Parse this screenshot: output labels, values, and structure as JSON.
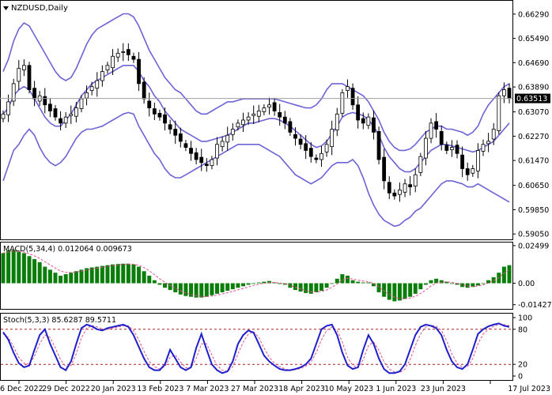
{
  "symbol_label": "NZDUSD,Daily",
  "current_price": "0.63513",
  "colors": {
    "background": "#ffffff",
    "frame": "#000000",
    "bull": "#ffffff",
    "bear": "#000000",
    "bollinger": "#6b63d6",
    "price_line": "#a0a0a0",
    "price_box": "#000000",
    "price_box_text": "#ffffff",
    "macd_hist": "#0a7d0a",
    "macd_signal": "#e0508a",
    "stoch_main": "#1f1fcc",
    "stoch_signal": "#e0508a",
    "stoch_level": "#b02020"
  },
  "price_panel": {
    "axis_labels": [
      "0.66290",
      "0.65490",
      "0.64690",
      "0.63890",
      "0.63070",
      "0.62270",
      "0.61470",
      "0.60650",
      "0.59850",
      "0.59050"
    ]
  },
  "macd_panel": {
    "label": "MACD(5,34,4) 0.012064 0.009673",
    "axis_labels": [
      "0.02499",
      "0.00",
      "-0.01427"
    ]
  },
  "stoch_panel": {
    "label": "Stoch(5,3,3) 85.6287 89.5711",
    "axis_labels": [
      "100",
      "80",
      "20",
      "0"
    ]
  },
  "time_axis": {
    "labels": [
      "6 Dec 2022",
      "29 Dec 2022",
      "20 Jan 2023",
      "13 Feb 2023",
      "7 Mar 2023",
      "27 Mar 2023",
      "18 Apr 2023",
      "10 May 2023",
      "1 Jun 2023",
      "23 Jun 2023",
      "17 Jul 2023"
    ]
  },
  "chart_data": {
    "type": "line",
    "title": "NZDUSD,Daily",
    "price_range": [
      0.5895,
      0.6665
    ],
    "close": [
      0.63,
      0.634,
      0.64,
      0.645,
      0.646,
      0.638,
      0.635,
      0.636,
      0.633,
      0.631,
      0.629,
      0.627,
      0.629,
      0.63,
      0.632,
      0.635,
      0.637,
      0.639,
      0.641,
      0.644,
      0.646,
      0.649,
      0.65,
      0.6505,
      0.6495,
      0.648,
      0.64,
      0.635,
      0.632,
      0.63,
      0.629,
      0.627,
      0.625,
      0.623,
      0.621,
      0.619,
      0.617,
      0.615,
      0.614,
      0.613,
      0.615,
      0.62,
      0.621,
      0.623,
      0.625,
      0.627,
      0.628,
      0.629,
      0.63,
      0.631,
      0.632,
      0.633,
      0.631,
      0.629,
      0.627,
      0.624,
      0.622,
      0.62,
      0.618,
      0.616,
      0.615,
      0.617,
      0.62,
      0.625,
      0.63,
      0.637,
      0.639,
      0.633,
      0.628,
      0.627,
      0.629,
      0.624,
      0.615,
      0.608,
      0.604,
      0.603,
      0.605,
      0.607,
      0.606,
      0.61,
      0.616,
      0.622,
      0.627,
      0.625,
      0.62,
      0.618,
      0.619,
      0.617,
      0.612,
      0.61,
      0.612,
      0.618,
      0.62,
      0.621,
      0.625,
      0.636,
      0.638,
      0.6351
    ],
    "bb_upper": [
      0.644,
      0.648,
      0.654,
      0.658,
      0.66,
      0.659,
      0.656,
      0.653,
      0.65,
      0.647,
      0.644,
      0.642,
      0.641,
      0.642,
      0.645,
      0.649,
      0.653,
      0.656,
      0.658,
      0.659,
      0.66,
      0.661,
      0.662,
      0.663,
      0.663,
      0.662,
      0.659,
      0.655,
      0.651,
      0.648,
      0.645,
      0.642,
      0.64,
      0.638,
      0.637,
      0.635,
      0.633,
      0.631,
      0.63,
      0.63,
      0.631,
      0.632,
      0.633,
      0.634,
      0.634,
      0.6345,
      0.635,
      0.635,
      0.635,
      0.635,
      0.635,
      0.635,
      0.635,
      0.6345,
      0.634,
      0.6335,
      0.633,
      0.6325,
      0.632,
      0.632,
      0.633,
      0.635,
      0.638,
      0.64,
      0.64,
      0.64,
      0.639,
      0.638,
      0.637,
      0.636,
      0.634,
      0.631,
      0.628,
      0.624,
      0.621,
      0.619,
      0.618,
      0.618,
      0.6185,
      0.62,
      0.622,
      0.624,
      0.625,
      0.626,
      0.626,
      0.625,
      0.625,
      0.6245,
      0.624,
      0.623,
      0.624,
      0.626,
      0.63,
      0.633,
      0.635,
      0.637,
      0.639,
      0.64
    ],
    "bb_middle": [
      0.63,
      0.632,
      0.636,
      0.638,
      0.639,
      0.638,
      0.635,
      0.632,
      0.629,
      0.627,
      0.626,
      0.626,
      0.628,
      0.63,
      0.633,
      0.636,
      0.638,
      0.64,
      0.641,
      0.642,
      0.643,
      0.644,
      0.645,
      0.646,
      0.646,
      0.646,
      0.644,
      0.641,
      0.639,
      0.636,
      0.634,
      0.631,
      0.629,
      0.627,
      0.625,
      0.624,
      0.623,
      0.622,
      0.621,
      0.621,
      0.6215,
      0.622,
      0.6225,
      0.623,
      0.624,
      0.625,
      0.626,
      0.627,
      0.627,
      0.6275,
      0.628,
      0.6285,
      0.6285,
      0.628,
      0.627,
      0.626,
      0.6245,
      0.623,
      0.6215,
      0.62,
      0.619,
      0.6195,
      0.621,
      0.6235,
      0.626,
      0.629,
      0.63,
      0.6305,
      0.63,
      0.6295,
      0.628,
      0.626,
      0.623,
      0.619,
      0.616,
      0.614,
      0.612,
      0.611,
      0.611,
      0.612,
      0.614,
      0.616,
      0.618,
      0.619,
      0.62,
      0.62,
      0.6195,
      0.619,
      0.6185,
      0.618,
      0.6175,
      0.618,
      0.619,
      0.62,
      0.621,
      0.623,
      0.625,
      0.627
    ],
    "bb_lower": [
      0.608,
      0.613,
      0.618,
      0.62,
      0.623,
      0.625,
      0.623,
      0.619,
      0.616,
      0.614,
      0.613,
      0.614,
      0.616,
      0.619,
      0.622,
      0.624,
      0.625,
      0.625,
      0.6255,
      0.626,
      0.627,
      0.628,
      0.629,
      0.63,
      0.6305,
      0.63,
      0.626,
      0.623,
      0.62,
      0.617,
      0.615,
      0.612,
      0.61,
      0.609,
      0.609,
      0.61,
      0.611,
      0.612,
      0.613,
      0.614,
      0.615,
      0.616,
      0.617,
      0.618,
      0.619,
      0.62,
      0.62,
      0.62,
      0.62,
      0.62,
      0.619,
      0.618,
      0.617,
      0.616,
      0.614,
      0.612,
      0.61,
      0.609,
      0.608,
      0.607,
      0.608,
      0.609,
      0.611,
      0.613,
      0.614,
      0.614,
      0.614,
      0.615,
      0.613,
      0.609,
      0.604,
      0.6,
      0.597,
      0.595,
      0.594,
      0.593,
      0.5935,
      0.595,
      0.596,
      0.598,
      0.599,
      0.601,
      0.603,
      0.605,
      0.607,
      0.608,
      0.608,
      0.6075,
      0.607,
      0.606,
      0.606,
      0.607,
      0.606,
      0.605,
      0.604,
      0.603,
      0.602,
      0.601
    ],
    "macd": {
      "range": [
        -0.016,
        0.026
      ],
      "histogram": [
        0.02,
        0.022,
        0.022,
        0.021,
        0.02,
        0.018,
        0.016,
        0.014,
        0.011,
        0.009,
        0.007,
        0.005,
        0.006,
        0.007,
        0.008,
        0.009,
        0.01,
        0.0105,
        0.011,
        0.0115,
        0.012,
        0.0125,
        0.0128,
        0.013,
        0.013,
        0.0125,
        0.011,
        0.008,
        0.005,
        0.002,
        -0.001,
        -0.003,
        -0.0045,
        -0.006,
        -0.0075,
        -0.0085,
        -0.009,
        -0.0095,
        -0.0095,
        -0.009,
        -0.008,
        -0.007,
        -0.006,
        -0.005,
        -0.004,
        -0.003,
        -0.002,
        -0.001,
        0.0,
        0.0005,
        0.001,
        0.0015,
        0.0005,
        -0.0005,
        -0.001,
        -0.003,
        -0.0045,
        -0.0055,
        -0.0065,
        -0.007,
        -0.006,
        -0.005,
        -0.003,
        0.0,
        0.003,
        0.006,
        0.005,
        0.002,
        0.001,
        0.0005,
        0.0005,
        -0.002,
        -0.006,
        -0.009,
        -0.011,
        -0.012,
        -0.0115,
        -0.0105,
        -0.009,
        -0.007,
        -0.004,
        -0.001,
        0.002,
        0.003,
        0.002,
        0.001,
        0.0,
        -0.001,
        -0.0025,
        -0.003,
        -0.0025,
        -0.0015,
        0.0,
        0.002,
        0.004,
        0.007,
        0.011,
        0.012
      ]
    },
    "stoch": {
      "range": [
        0,
        100
      ],
      "levels": [
        80,
        20
      ],
      "k": [
        75,
        62,
        40,
        22,
        15,
        18,
        45,
        70,
        80,
        55,
        35,
        15,
        10,
        25,
        55,
        82,
        88,
        85,
        80,
        78,
        82,
        84,
        86,
        88,
        84,
        70,
        50,
        30,
        15,
        10,
        10,
        20,
        45,
        30,
        15,
        10,
        15,
        48,
        72,
        45,
        20,
        10,
        5,
        8,
        25,
        55,
        70,
        78,
        74,
        55,
        35,
        25,
        18,
        12,
        10,
        10,
        12,
        15,
        20,
        30,
        55,
        80,
        86,
        88,
        70,
        40,
        18,
        12,
        15,
        45,
        70,
        55,
        30,
        12,
        5,
        5,
        8,
        20,
        45,
        70,
        84,
        88,
        86,
        82,
        70,
        45,
        25,
        15,
        12,
        20,
        45,
        72,
        80,
        85,
        88,
        90,
        86,
        84
      ],
      "d": [
        72,
        66,
        50,
        32,
        22,
        20,
        34,
        55,
        70,
        66,
        48,
        28,
        16,
        18,
        38,
        65,
        82,
        86,
        84,
        80,
        80,
        82,
        84,
        86,
        86,
        78,
        62,
        42,
        25,
        16,
        12,
        16,
        32,
        36,
        24,
        14,
        14,
        30,
        55,
        55,
        36,
        18,
        10,
        8,
        16,
        38,
        58,
        72,
        76,
        66,
        48,
        32,
        22,
        16,
        12,
        10,
        11,
        13,
        17,
        24,
        40,
        62,
        78,
        84,
        78,
        58,
        32,
        18,
        14,
        28,
        52,
        58,
        44,
        24,
        12,
        7,
        6,
        12,
        28,
        52,
        72,
        84,
        87,
        85,
        78,
        60,
        38,
        22,
        15,
        16,
        30,
        55,
        72,
        80,
        85,
        88,
        88,
        86
      ]
    }
  }
}
